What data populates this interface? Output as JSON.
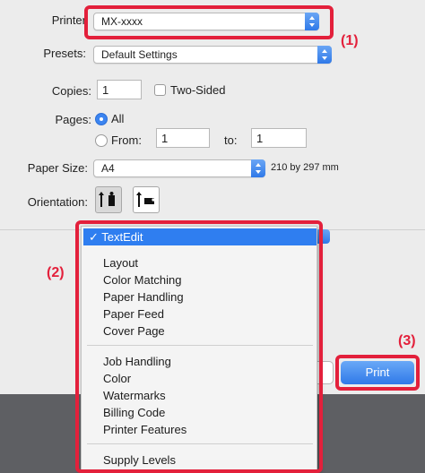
{
  "dialog": {
    "printer": {
      "label": "Printer",
      "value": "MX-xxxx"
    },
    "presets": {
      "label": "Presets:",
      "value": "Default Settings"
    },
    "copies": {
      "label": "Copies:",
      "value": "1",
      "two_sided_label": "Two-Sided"
    },
    "pages": {
      "label": "Pages:",
      "all_label": "All",
      "from_label": "From:",
      "from_value": "1",
      "to_label": "to:",
      "to_value": "1"
    },
    "paper_size": {
      "label": "Paper Size:",
      "value": "A4",
      "dimensions": "210 by 297 mm"
    },
    "orientation": {
      "label": "Orientation:"
    },
    "print_button": "Print"
  },
  "menu": {
    "selected": "✓ TextEdit",
    "group1": [
      "Layout",
      "Color Matching",
      "Paper Handling",
      "Paper Feed",
      "Cover Page"
    ],
    "group2": [
      "Job Handling",
      "Color",
      "Watermarks",
      "Billing Code",
      "Printer Features"
    ],
    "group3": [
      "Supply Levels"
    ]
  },
  "callouts": {
    "c1": "(1)",
    "c2": "(2)",
    "c3": "(3)"
  },
  "colors": {
    "accent": "#2f7ef0",
    "highlight": "#e3203b",
    "dialog_bg": "#ececec",
    "bottom_bar": "#5e5f63"
  }
}
